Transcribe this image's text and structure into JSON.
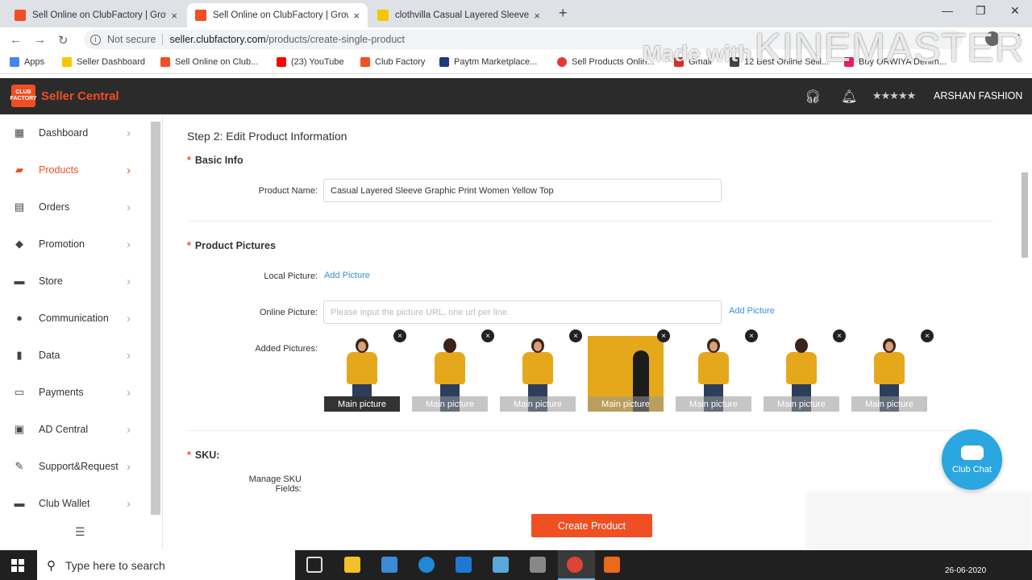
{
  "browser": {
    "tabs": [
      {
        "label": "Sell Online on ClubFactory | Grow",
        "favicon_color": "#f04e23",
        "active": false
      },
      {
        "label": "Sell Online on ClubFactory | Grow",
        "favicon_color": "#f04e23",
        "active": true
      },
      {
        "label": "clothvilla Casual Layered Sleeve G",
        "favicon_color": "#f7c600",
        "active": false
      }
    ],
    "tab_close_glyph": "×",
    "new_tab_glyph": "+",
    "url_not_secure": "Not secure",
    "url_host": "seller.clubfactory.com",
    "url_path": "/products/create-single-product",
    "bookmarks": [
      {
        "label": "Apps",
        "color": "#4285f4"
      },
      {
        "label": "Seller Dashboard",
        "color": "#f7c600"
      },
      {
        "label": "Sell Online on Club...",
        "color": "#f04e23"
      },
      {
        "label": "(23) YouTube",
        "color": "#ff0000"
      },
      {
        "label": "Club Factory",
        "color": "#f04e23"
      },
      {
        "label": "Paytm Marketplace...",
        "color": "#1a3c7a"
      },
      {
        "label": "Sell Products Onlin...",
        "color": "#e53935"
      },
      {
        "label": "Gmail",
        "color": "#d93025"
      },
      {
        "label": "12 Best Online Selli...",
        "color": "#444444"
      },
      {
        "label": "Buy ORWIYA Denim...",
        "color": "#e91e63"
      }
    ],
    "watermark_line1": "Made with",
    "watermark_line2": "KINEMASTER"
  },
  "header": {
    "logo_text": "CLUB FACTORY",
    "brand": "Seller Central",
    "account_name": "ARSHAN FASHION",
    "accent_color": "#f04e23"
  },
  "sidebar": {
    "items": [
      {
        "label": "Dashboard",
        "icon": "dashboard-icon",
        "glyph": "▦",
        "active": false
      },
      {
        "label": "Products",
        "icon": "products-icon",
        "glyph": "▰",
        "active": true
      },
      {
        "label": "Orders",
        "icon": "orders-icon",
        "glyph": "▤",
        "active": false
      },
      {
        "label": "Promotion",
        "icon": "tag-icon",
        "glyph": "◆",
        "active": false
      },
      {
        "label": "Store",
        "icon": "store-icon",
        "glyph": "▬",
        "active": false
      },
      {
        "label": "Communication",
        "icon": "chat-icon",
        "glyph": "●",
        "active": false
      },
      {
        "label": "Data",
        "icon": "bar-chart-icon",
        "glyph": "▮",
        "active": false
      },
      {
        "label": "Payments",
        "icon": "card-icon",
        "glyph": "▭",
        "active": false
      },
      {
        "label": "AD Central",
        "icon": "ad-icon",
        "glyph": "▣",
        "active": false
      },
      {
        "label": "Support&Request",
        "icon": "wrench-icon",
        "glyph": "✎",
        "active": false
      },
      {
        "label": "Club Wallet",
        "icon": "wallet-icon",
        "glyph": "▬",
        "active": false
      }
    ],
    "arrow_glyph": "›"
  },
  "form": {
    "step_title": "Step 2: Edit Product Information",
    "basic_info": "Basic Info",
    "product_name_label": "Product Name:",
    "product_name_value": "Casual Layered Sleeve Graphic Print Women Yellow Top",
    "pictures_title": "Product Pictures",
    "local_picture_label": "Local Picture:",
    "add_picture_link": "Add Picture",
    "online_picture_label": "Online Picture:",
    "online_picture_placeholder": "Please input the picture URL, one url per line.",
    "online_add_picture_link": "Add Picture",
    "added_pictures_label": "Added Pictures:",
    "pictures": [
      {
        "caption": "Main picture",
        "main": true
      },
      {
        "caption": "Main picture",
        "main": false
      },
      {
        "caption": "Main picture",
        "main": false
      },
      {
        "caption": "Main picture",
        "main": false
      },
      {
        "caption": "Main picture",
        "main": false
      },
      {
        "caption": "Main picture",
        "main": false
      },
      {
        "caption": "Main picture",
        "main": false
      }
    ],
    "remove_glyph": "×",
    "sku_title": "SKU:",
    "manage_sku_label": "Manage SKU Fields:",
    "create_button": "Create Product"
  },
  "chat": {
    "label": "Club Chat"
  },
  "taskbar": {
    "search_placeholder": "Type here to search",
    "date": "26-06-2020"
  }
}
